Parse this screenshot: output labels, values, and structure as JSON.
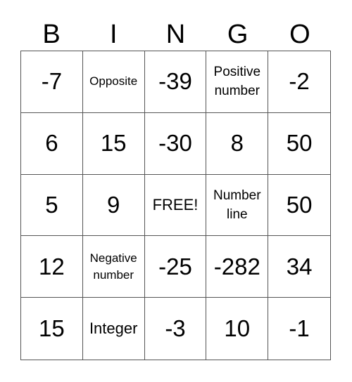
{
  "header": [
    "B",
    "I",
    "N",
    "G",
    "O"
  ],
  "cells": [
    "-7",
    "Opposite",
    "-39",
    "Positive number",
    "-2",
    "6",
    "15",
    "-30",
    "8",
    "50",
    "5",
    "9",
    "FREE!",
    "Number line",
    "50",
    "12",
    "Negative number",
    "-25",
    "-282",
    "34",
    "15",
    "Integer",
    "-3",
    "10",
    "-1"
  ]
}
